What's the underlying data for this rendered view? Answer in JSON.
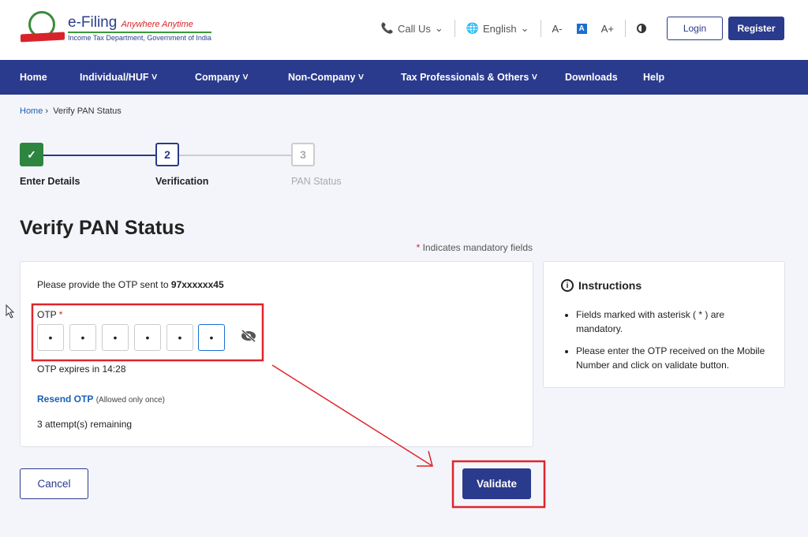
{
  "header": {
    "logo_title": "e-Filing",
    "logo_tagline": "Anywhere Anytime",
    "logo_subtitle": "Income Tax Department, Government of India",
    "call_us": "Call Us",
    "language": "English",
    "font_decrease": "A-",
    "font_default": "A",
    "font_increase": "A+",
    "login": "Login",
    "register": "Register"
  },
  "nav": {
    "items": [
      "Home",
      "Individual/HUF",
      "Company",
      "Non-Company",
      "Tax Professionals & Others",
      "Downloads",
      "Help"
    ]
  },
  "breadcrumb": {
    "home": "Home",
    "current": "Verify PAN Status"
  },
  "stepper": {
    "steps": [
      {
        "num": "✓",
        "label": "Enter Details",
        "state": "done"
      },
      {
        "num": "2",
        "label": "Verification",
        "state": "active"
      },
      {
        "num": "3",
        "label": "PAN Status",
        "state": "pending"
      }
    ]
  },
  "page": {
    "title": "Verify PAN Status",
    "mandatory_note": "Indicates mandatory fields",
    "asterisk": "*"
  },
  "otp_card": {
    "prompt": "Please provide the OTP sent to",
    "mobile": "97xxxxxx45",
    "otp_label": "OTP",
    "otp_values": [
      "•",
      "•",
      "•",
      "•",
      "•",
      "•"
    ],
    "expires": "OTP expires in 14:28",
    "resend": "Resend OTP",
    "resend_note": "(Allowed only once)",
    "attempts": "3 attempt(s) remaining"
  },
  "instructions": {
    "title": "Instructions",
    "items": [
      "Fields marked with asterisk ( * ) are mandatory.",
      "Please enter the OTP received on the Mobile Number and click on validate button."
    ]
  },
  "actions": {
    "cancel": "Cancel",
    "validate": "Validate"
  },
  "colors": {
    "primary": "#2a3a8c",
    "success": "#2e8540",
    "annotation": "#e0242b",
    "link": "#1a5fb4"
  }
}
